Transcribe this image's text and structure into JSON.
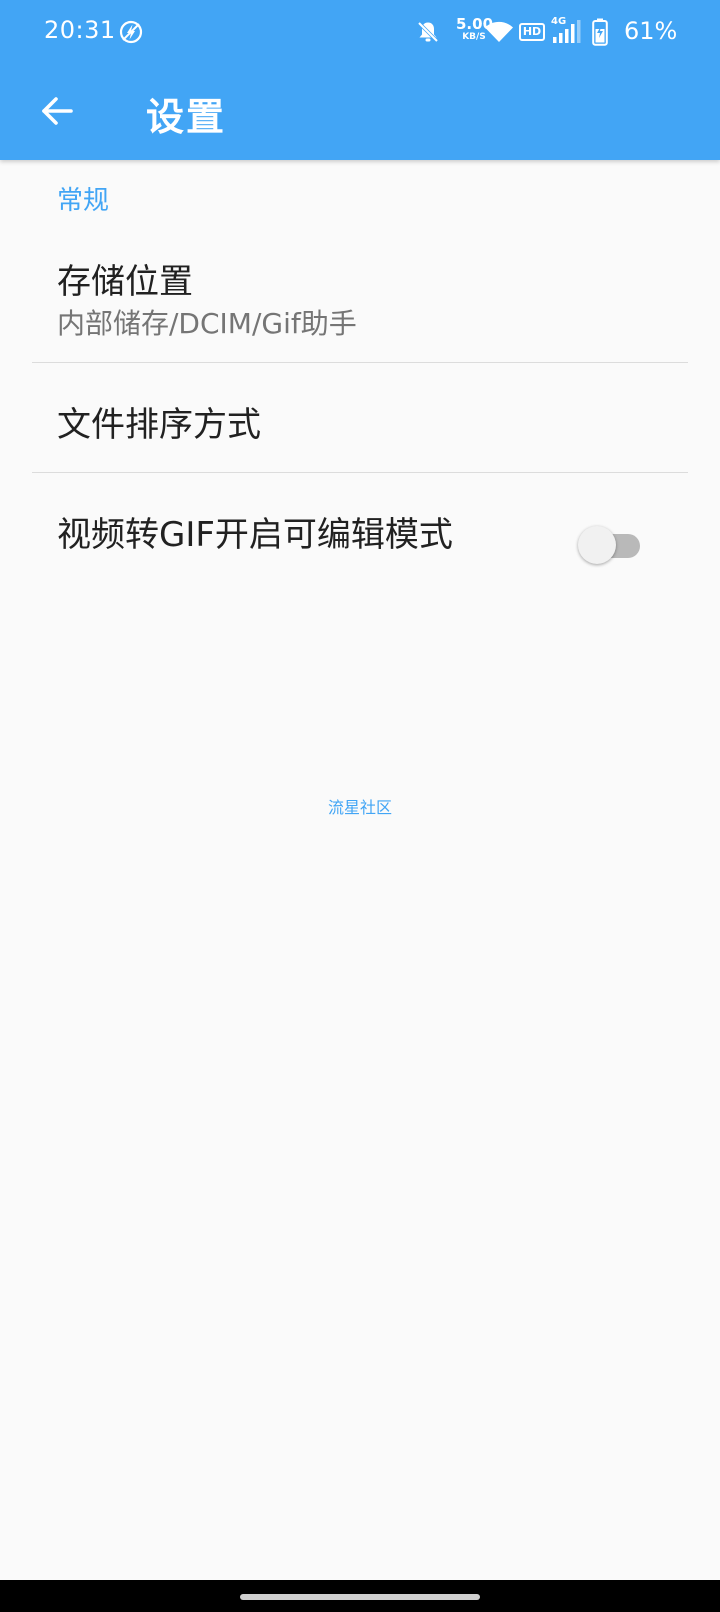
{
  "status_bar": {
    "time": "20:31",
    "net_speed_value": "5.00",
    "net_speed_unit": "KB/S",
    "hd_label": "HD",
    "network_type": "4G",
    "battery_percent": "61%",
    "icons": [
      "no-location-icon",
      "bell-off-icon",
      "wifi-icon",
      "hd-icon",
      "cellular-signal-icon",
      "battery-charging-icon"
    ]
  },
  "app_bar": {
    "title": "设置",
    "back_icon": "arrow-left-icon"
  },
  "settings": {
    "category": "常规",
    "items": [
      {
        "title": "存储位置",
        "summary": "内部储存/DCIM/Gif助手"
      },
      {
        "title": "文件排序方式"
      },
      {
        "title": "视频转GIF开启可编辑模式",
        "switch_on": false
      }
    ]
  },
  "footer": {
    "link": "流星社区"
  },
  "colors": {
    "primary": "#42a5f5",
    "background": "#fafafa",
    "text_primary": "#212121",
    "text_secondary": "#757575"
  }
}
